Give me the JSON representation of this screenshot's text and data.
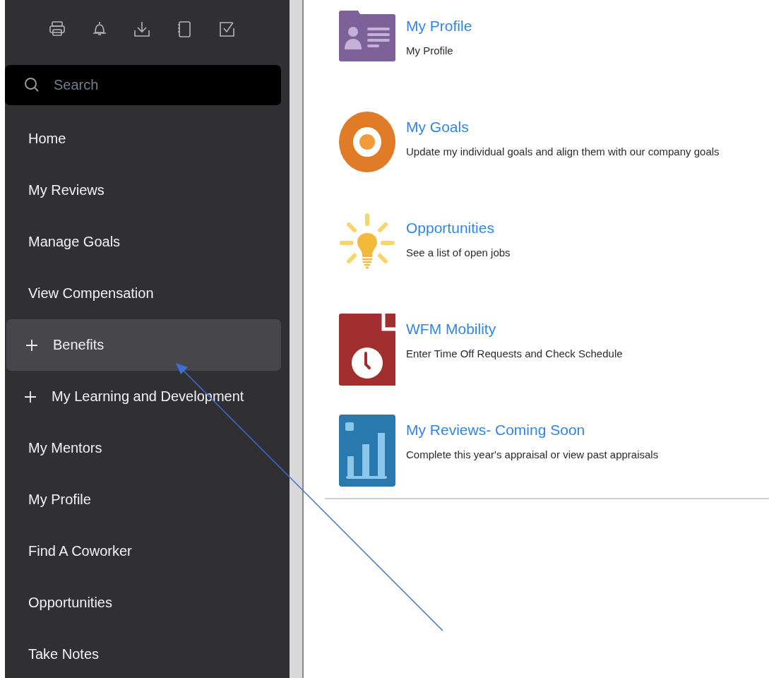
{
  "toolbar": {
    "icons": [
      {
        "kind": "printer"
      },
      {
        "kind": "bell"
      },
      {
        "kind": "download"
      },
      {
        "kind": "notebook"
      },
      {
        "kind": "checkbox"
      }
    ]
  },
  "search": {
    "placeholder": "Search"
  },
  "sidebar": {
    "items": [
      {
        "label": "Home",
        "expandable": false,
        "selected": false
      },
      {
        "label": "My Reviews",
        "expandable": false,
        "selected": false
      },
      {
        "label": "Manage Goals",
        "expandable": false,
        "selected": false
      },
      {
        "label": "View Compensation",
        "expandable": false,
        "selected": false
      },
      {
        "label": "Benefits",
        "expandable": true,
        "selected": true
      },
      {
        "label": "My Learning and Development",
        "expandable": true,
        "selected": false
      },
      {
        "label": "My Mentors",
        "expandable": false,
        "selected": false
      },
      {
        "label": "My Profile",
        "expandable": false,
        "selected": false
      },
      {
        "label": "Find A Coworker",
        "expandable": false,
        "selected": false
      },
      {
        "label": "Opportunities",
        "expandable": false,
        "selected": false
      },
      {
        "label": "Take Notes",
        "expandable": false,
        "selected": false
      }
    ]
  },
  "tiles": [
    {
      "kind": "profile",
      "title": "My Profile",
      "description": "My Profile"
    },
    {
      "kind": "goals",
      "title": "My Goals",
      "description": "Update my individual goals and align them with our company goals"
    },
    {
      "kind": "idea",
      "title": "Opportunities",
      "description": "See a list of open jobs"
    },
    {
      "kind": "clock",
      "title": "WFM Mobility",
      "description": "Enter Time Off Requests and Check Schedule"
    },
    {
      "kind": "chart",
      "title": "My Reviews- Coming Soon",
      "description": "Complete this year's appraisal or view past appraisals"
    }
  ]
}
